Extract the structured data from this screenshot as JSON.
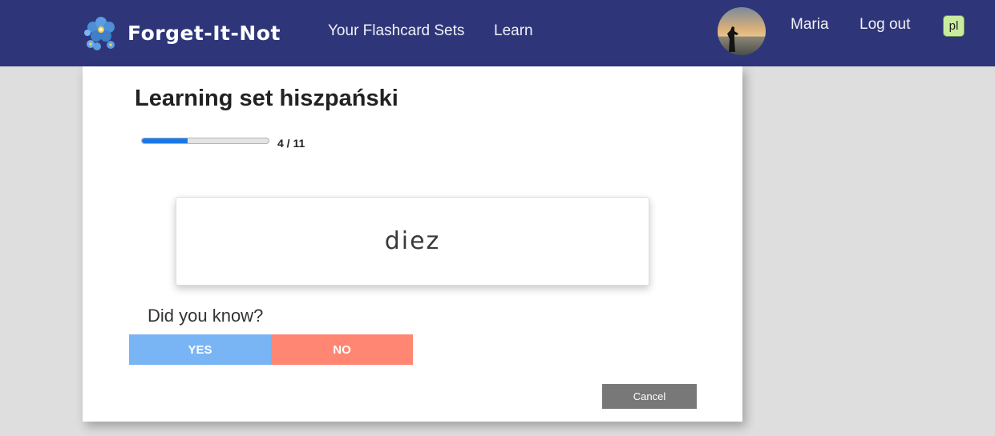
{
  "navbar": {
    "brand": "Forget-It-Not",
    "logo_icon": "forget-me-not-flower-icon",
    "links": [
      "Your Flashcard Sets",
      "Learn"
    ],
    "user_name": "Maria",
    "logout": "Log out",
    "language": "pl"
  },
  "learning": {
    "title_prefix": "Learning set ",
    "set_name": "hiszpański",
    "progress": {
      "current": 4,
      "total": 11,
      "label": "4 / 11"
    },
    "card_word": "diez",
    "question": "Did you know?",
    "yes_label": "YES",
    "no_label": "NO",
    "cancel_label": "Cancel"
  },
  "colors": {
    "navbar": "#2e3679",
    "progress": "#1a78e6",
    "yes": "#79b5f5",
    "no": "#ff8672",
    "cancel": "#787878",
    "language_badge": "#c9eb9f"
  }
}
